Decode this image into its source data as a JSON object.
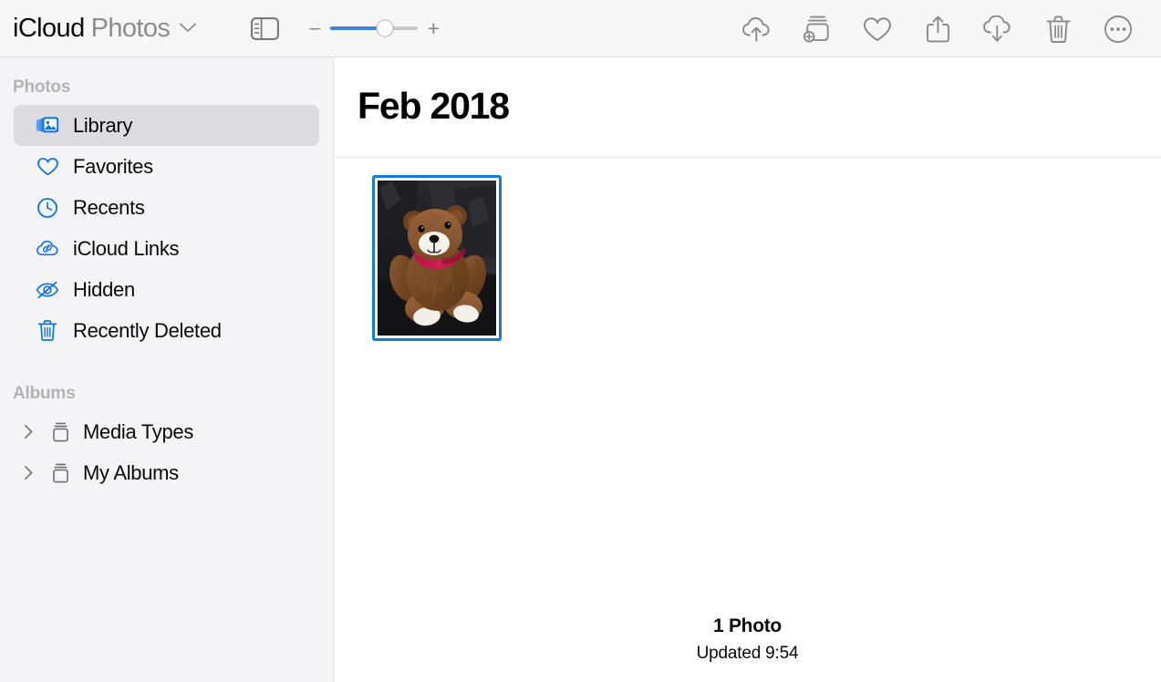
{
  "window": {
    "title_primary": "iCloud",
    "title_secondary": "Photos",
    "title_chevron_icon": "chevron-down-icon"
  },
  "toolbar": {
    "sidebar_toggle_icon": "sidebar-toggle-icon",
    "zoom": {
      "minus_label": "–",
      "plus_label": "+",
      "value_percent": 62
    },
    "actions": [
      {
        "name": "upload-button",
        "icon": "cloud-upload-icon"
      },
      {
        "name": "add-to-album-button",
        "icon": "add-to-album-icon"
      },
      {
        "name": "favorite-button",
        "icon": "heart-icon"
      },
      {
        "name": "share-button",
        "icon": "share-icon"
      },
      {
        "name": "download-button",
        "icon": "cloud-download-icon"
      },
      {
        "name": "delete-button",
        "icon": "trash-icon"
      },
      {
        "name": "more-button",
        "icon": "ellipsis-circle-icon"
      }
    ]
  },
  "sidebar": {
    "photos_header": "Photos",
    "photos_items": [
      {
        "label": "Library",
        "icon": "photo-stack-icon",
        "selected": true
      },
      {
        "label": "Favorites",
        "icon": "heart-outline-icon",
        "selected": false
      },
      {
        "label": "Recents",
        "icon": "clock-icon",
        "selected": false
      },
      {
        "label": "iCloud Links",
        "icon": "cloud-link-icon",
        "selected": false
      },
      {
        "label": "Hidden",
        "icon": "eye-slash-icon",
        "selected": false
      },
      {
        "label": "Recently Deleted",
        "icon": "trash-outline-icon",
        "selected": false
      }
    ],
    "albums_header": "Albums",
    "albums_items": [
      {
        "label": "Media Types",
        "icon": "album-box-icon",
        "disclosure": "chevron-right-icon"
      },
      {
        "label": "My Albums",
        "icon": "album-box-icon",
        "disclosure": "chevron-right-icon"
      }
    ]
  },
  "main": {
    "month_title": "Feb 2018",
    "photos": [
      {
        "alt": "teddy-bear-photo",
        "selected": true
      }
    ],
    "status_count": "1 Photo",
    "status_updated": "Updated 9:54"
  },
  "colors": {
    "accent_blue": "#1274e0",
    "selection_blue": "#1878e0",
    "slider_fill": "#3a85e8",
    "sidebar_bg": "#f4f4f6",
    "toolbar_bg": "#f6f6f6",
    "icon_gray": "#8a8a8e",
    "header_gray": "#b3b3b6"
  }
}
